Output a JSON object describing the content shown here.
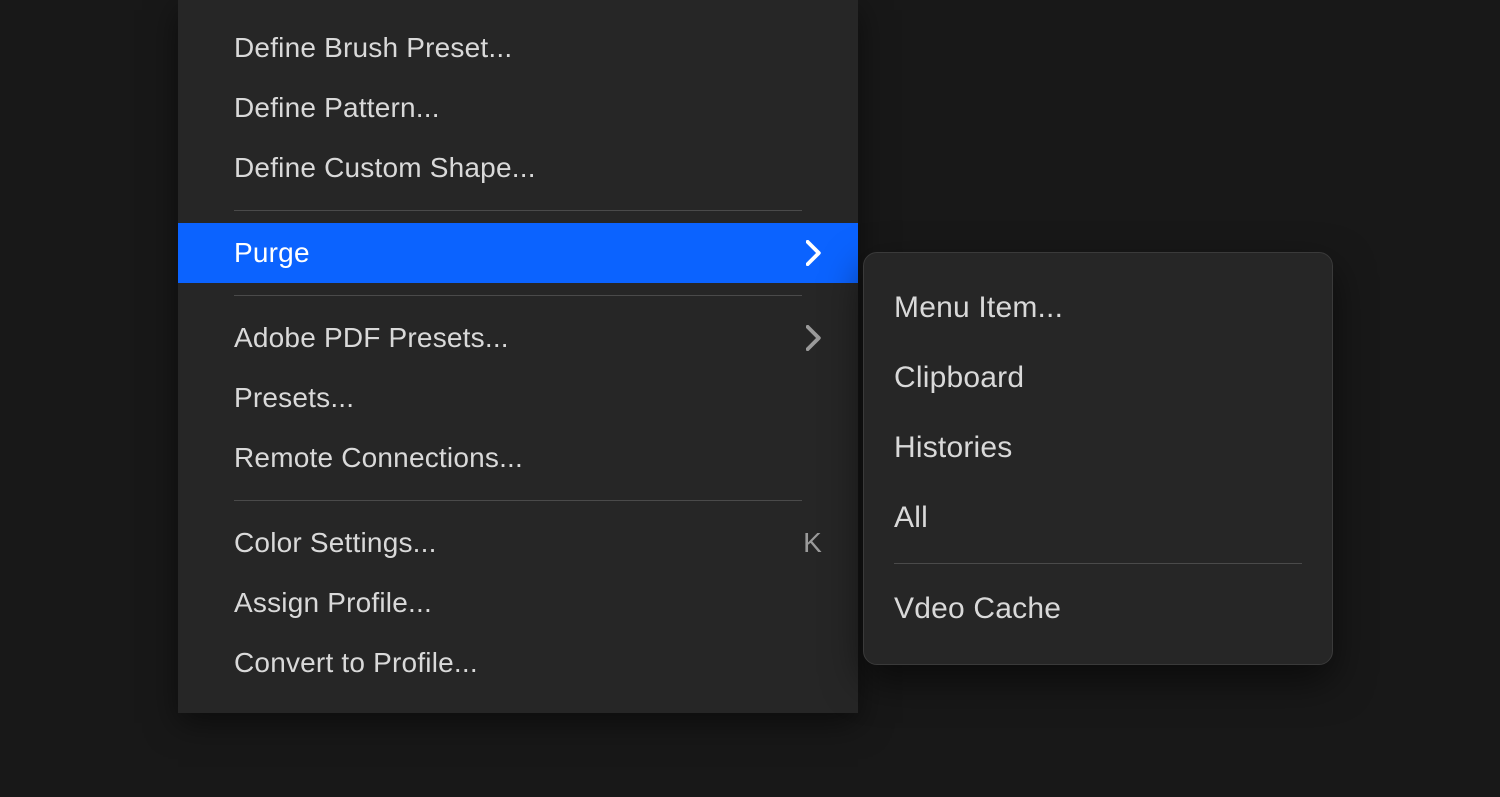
{
  "menu": {
    "items": [
      {
        "label": "Define Brush Preset..."
      },
      {
        "label": "Define Pattern..."
      },
      {
        "label": "Define Custom Shape..."
      },
      {
        "label": "Purge",
        "hasSubmenu": true,
        "highlighted": true
      },
      {
        "label": "Adobe PDF Presets...",
        "hasSubmenu": true
      },
      {
        "label": "Presets..."
      },
      {
        "label": "Remote Connections..."
      },
      {
        "label": "Color Settings...",
        "shortcut": "K"
      },
      {
        "label": "Assign Profile..."
      },
      {
        "label": "Convert to Profile..."
      }
    ]
  },
  "submenu": {
    "items": [
      {
        "label": "Menu Item..."
      },
      {
        "label": "Clipboard"
      },
      {
        "label": "Histories"
      },
      {
        "label": "All"
      },
      {
        "label": "Vdeo Cache"
      }
    ]
  }
}
